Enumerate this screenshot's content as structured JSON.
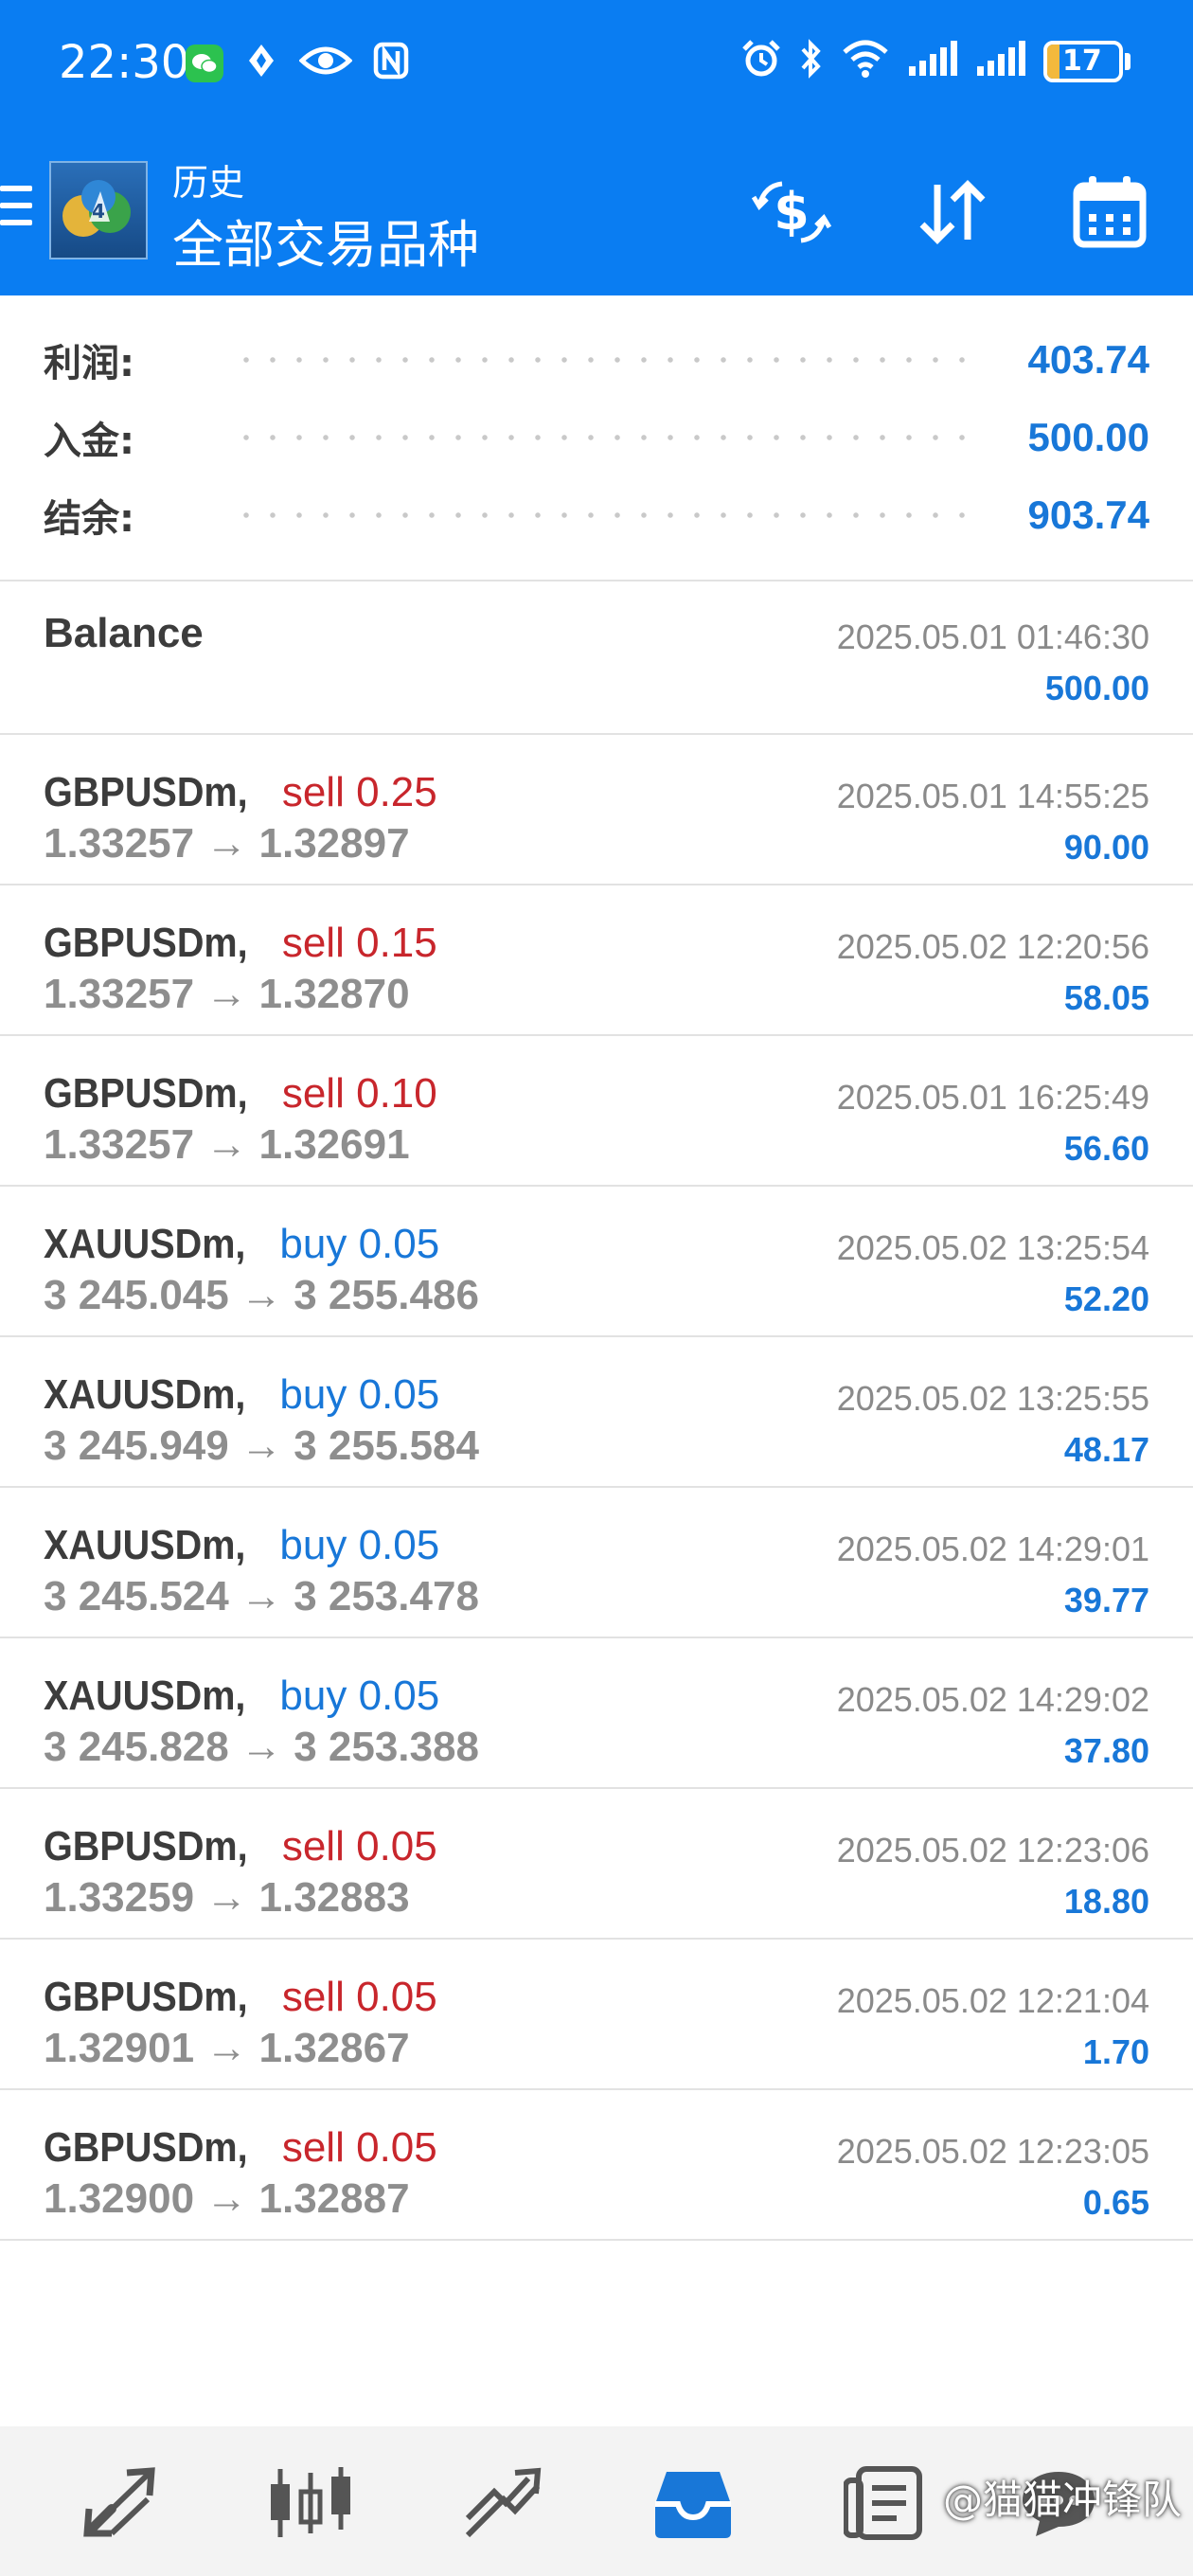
{
  "status_bar": {
    "time": "22:30",
    "left_icons": [
      "wechat-icon",
      "location-icon",
      "eye-icon",
      "nfc-icon"
    ],
    "right_icons": [
      "alarm-icon",
      "bluetooth-icon",
      "wifi-icon",
      "signal-icon",
      "signal-icon"
    ],
    "battery_level": "17",
    "battery_fraction": 0.17
  },
  "header": {
    "subtitle": "历史",
    "title": "全部交易品种",
    "actions": [
      "currency-exchange-icon",
      "sort-icon",
      "calendar-icon"
    ]
  },
  "summary": [
    {
      "label": "利润:",
      "value": "403.74"
    },
    {
      "label": "入金:",
      "value": "500.00"
    },
    {
      "label": "结余:",
      "value": "903.74"
    }
  ],
  "balance_entry": {
    "label": "Balance",
    "datetime": "2025.05.01 01:46:30",
    "amount": "500.00"
  },
  "deals": [
    {
      "symbol": "GBPUSDm,",
      "side": "sell",
      "volume": "0.25",
      "open": "1.33257",
      "close": "1.32897",
      "datetime": "2025.05.01 14:55:25",
      "profit": "90.00"
    },
    {
      "symbol": "GBPUSDm,",
      "side": "sell",
      "volume": "0.15",
      "open": "1.33257",
      "close": "1.32870",
      "datetime": "2025.05.02 12:20:56",
      "profit": "58.05"
    },
    {
      "symbol": "GBPUSDm,",
      "side": "sell",
      "volume": "0.10",
      "open": "1.33257",
      "close": "1.32691",
      "datetime": "2025.05.01 16:25:49",
      "profit": "56.60"
    },
    {
      "symbol": "XAUUSDm,",
      "side": "buy",
      "volume": "0.05",
      "open": "3 245.045",
      "close": "3 255.486",
      "datetime": "2025.05.02 13:25:54",
      "profit": "52.20"
    },
    {
      "symbol": "XAUUSDm,",
      "side": "buy",
      "volume": "0.05",
      "open": "3 245.949",
      "close": "3 255.584",
      "datetime": "2025.05.02 13:25:55",
      "profit": "48.17"
    },
    {
      "symbol": "XAUUSDm,",
      "side": "buy",
      "volume": "0.05",
      "open": "3 245.524",
      "close": "3 253.478",
      "datetime": "2025.05.02 14:29:01",
      "profit": "39.77"
    },
    {
      "symbol": "XAUUSDm,",
      "side": "buy",
      "volume": "0.05",
      "open": "3 245.828",
      "close": "3 253.388",
      "datetime": "2025.05.02 14:29:02",
      "profit": "37.80"
    },
    {
      "symbol": "GBPUSDm,",
      "side": "sell",
      "volume": "0.05",
      "open": "1.33259",
      "close": "1.32883",
      "datetime": "2025.05.02 12:23:06",
      "profit": "18.80"
    },
    {
      "symbol": "GBPUSDm,",
      "side": "sell",
      "volume": "0.05",
      "open": "1.32901",
      "close": "1.32867",
      "datetime": "2025.05.02 12:21:04",
      "profit": "1.70"
    },
    {
      "symbol": "GBPUSDm,",
      "side": "sell",
      "volume": "0.05",
      "open": "1.32900",
      "close": "1.32887",
      "datetime": "2025.05.02 12:23:05",
      "profit": "0.65"
    }
  ],
  "bottom_nav": {
    "items": [
      "quotes-icon",
      "chart-icon",
      "trade-icon",
      "history-icon",
      "journal-icon",
      "chat-icon"
    ],
    "active_index": 3
  },
  "watermark": "@猫猫冲锋队",
  "colors": {
    "primary": "#0a7df2",
    "profit_blue": "#1877d8",
    "sell_red": "#c8262c",
    "price_gray": "#8e8e8e",
    "battery_yellow": "#f3b93c",
    "nav_active": "#1877d8",
    "nav_inactive": "#555555"
  }
}
